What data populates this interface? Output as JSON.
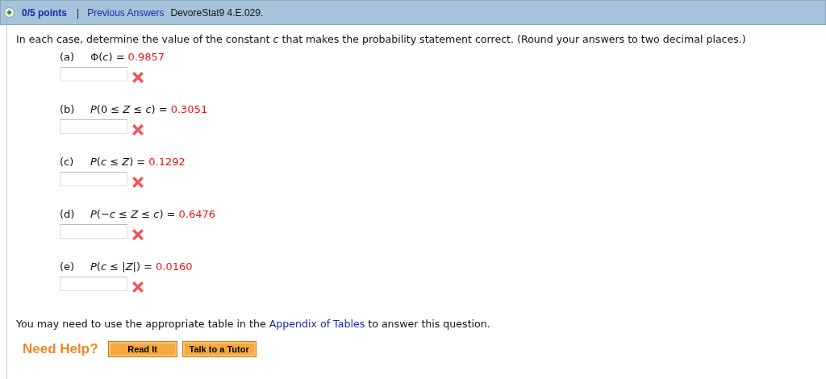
{
  "header": {
    "points": "0/5 points",
    "separator": "|",
    "previous_link": "Previous Answers",
    "problem_id": "DevoreStat9 4.E.029."
  },
  "intro": "In each case, determine the value of the constant *c* that makes the probability statement correct. (Round your answers to two decimal places.)",
  "parts": [
    {
      "label": "(a)",
      "expression": "Φ(*c*) =",
      "value": "0.9857",
      "correct": false
    },
    {
      "label": "(b)",
      "expression": "*P*(0 ≤ *Z* ≤ *c*) =",
      "value": "0.3051",
      "correct": false
    },
    {
      "label": "(c)",
      "expression": "*P*(*c* ≤ *Z*) =",
      "value": "0.1292",
      "correct": false
    },
    {
      "label": "(d)",
      "expression": "*P*(−*c* ≤ *Z* ≤ *c*) =",
      "value": "0.6476",
      "correct": false
    },
    {
      "label": "(e)",
      "expression": "*P*(*c* ≤ |*Z*|) =",
      "value": "0.0160",
      "correct": false
    }
  ],
  "note": {
    "before": "You may need to use the appropriate table in the",
    "link": "Appendix of Tables",
    "after": "to answer this question."
  },
  "help": {
    "label": "Need Help?",
    "buttons": [
      "Read It",
      "Talk to a Tutor"
    ]
  }
}
